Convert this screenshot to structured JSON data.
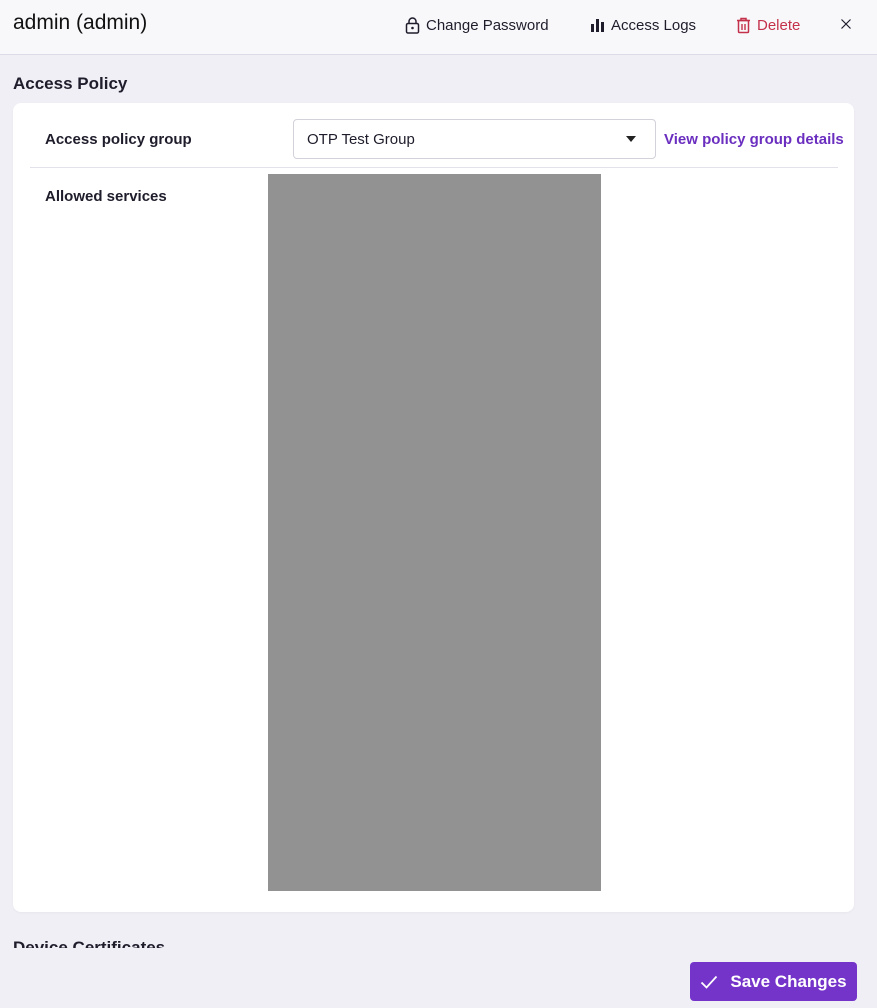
{
  "header": {
    "title": "admin (admin)",
    "change_password_label": "Change Password",
    "access_logs_label": "Access Logs",
    "delete_label": "Delete",
    "icons": {
      "change_password": "lock-icon",
      "access_logs": "bar-chart-icon",
      "delete": "trash-icon",
      "close": "close-icon"
    }
  },
  "access_policy": {
    "section_title": "Access Policy",
    "group_label": "Access policy group",
    "group_value": "OTP Test Group",
    "view_details_label": "View policy group details",
    "allowed_services_label": "Allowed services"
  },
  "next_section": {
    "title_partial": "Device Certificates"
  },
  "footer": {
    "save_label": "Save Changes"
  },
  "colors": {
    "accent": "#7434c9",
    "link": "#6b2fc0",
    "danger": "#c4314b",
    "background": "#f0eff5"
  }
}
